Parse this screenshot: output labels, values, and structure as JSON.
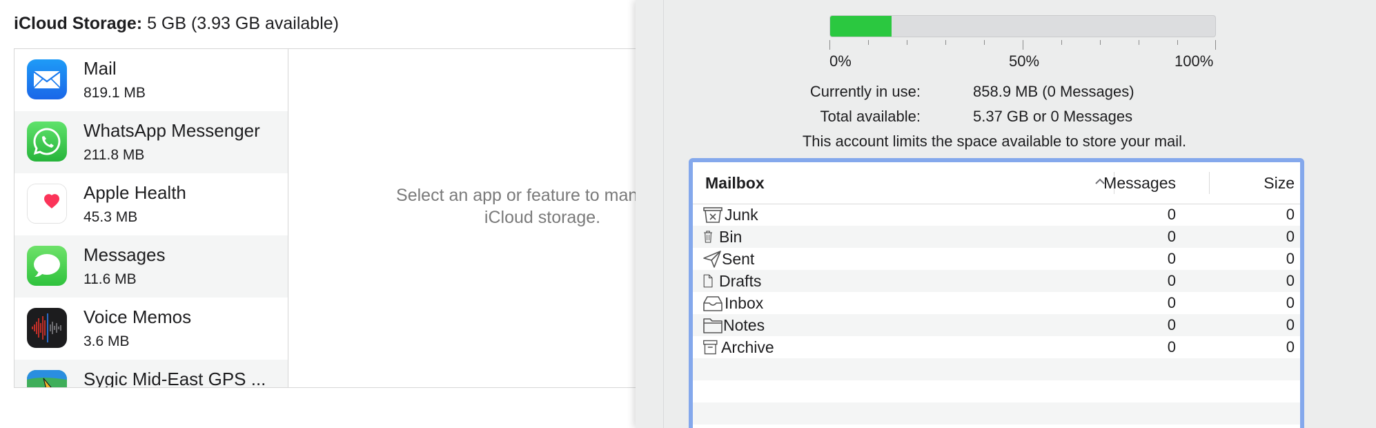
{
  "storage": {
    "label": "iCloud Storage:",
    "summary": "5 GB (3.93 GB available)"
  },
  "apps": [
    {
      "name": "Mail",
      "size": "819.1 MB",
      "icon": "mail-icon"
    },
    {
      "name": "WhatsApp Messenger",
      "size": "211.8 MB",
      "icon": "whatsapp-icon"
    },
    {
      "name": "Apple Health",
      "size": "45.3 MB",
      "icon": "health-icon"
    },
    {
      "name": "Messages",
      "size": "11.6 MB",
      "icon": "messages-icon"
    },
    {
      "name": "Voice Memos",
      "size": "3.6 MB",
      "icon": "voice-memos-icon"
    },
    {
      "name": "Sygic Mid-East GPS ...",
      "size": "",
      "icon": "sygic-icon"
    }
  ],
  "detail": {
    "placeholder": "Select an app or feature to manage its iCloud storage."
  },
  "mail_quota": {
    "usage_fraction": 0.16,
    "tick_labels": [
      "0%",
      "50%",
      "100%"
    ],
    "in_use_label": "Currently in use:",
    "in_use_value": "858.9 MB (0 Messages)",
    "available_label": "Total available:",
    "available_value": "5.37 GB or 0 Messages",
    "limit_note": "This account limits the space available to store your mail.",
    "colors": {
      "fill": "#2bc840",
      "track": "#dcdddf",
      "focus_ring": "#84a8ec"
    }
  },
  "mailbox_table": {
    "columns": {
      "mailbox": "Mailbox",
      "messages": "Messages",
      "size": "Size"
    },
    "rows": [
      {
        "name": "Junk",
        "messages": "0",
        "size": "0",
        "icon": "junk-icon"
      },
      {
        "name": "Bin",
        "messages": "0",
        "size": "0",
        "icon": "trash-icon"
      },
      {
        "name": "Sent",
        "messages": "0",
        "size": "0",
        "icon": "paper-plane-icon"
      },
      {
        "name": "Drafts",
        "messages": "0",
        "size": "0",
        "icon": "document-icon"
      },
      {
        "name": "Inbox",
        "messages": "0",
        "size": "0",
        "icon": "inbox-tray-icon"
      },
      {
        "name": "Notes",
        "messages": "0",
        "size": "0",
        "icon": "folder-icon"
      },
      {
        "name": "Archive",
        "messages": "0",
        "size": "0",
        "icon": "archive-box-icon"
      }
    ]
  }
}
